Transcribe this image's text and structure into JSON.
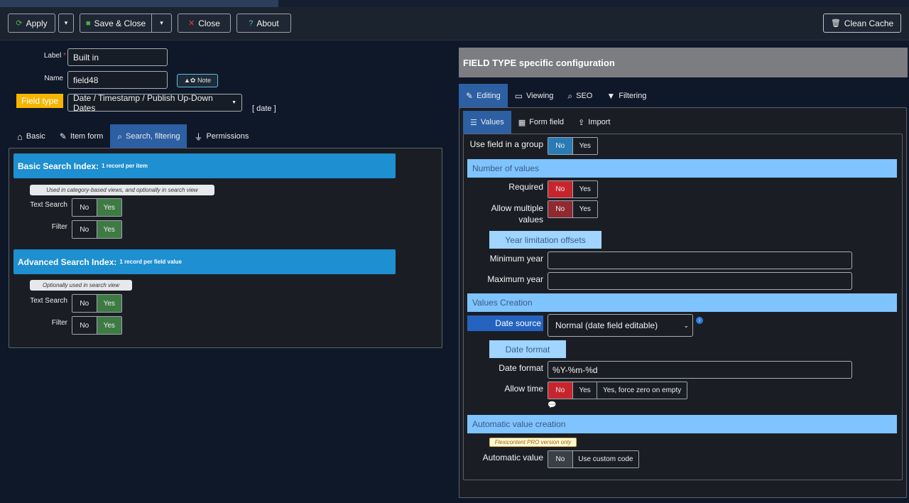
{
  "toolbar": {
    "apply": "Apply",
    "save_close": "Save & Close",
    "close": "Close",
    "about": "About",
    "clean_cache": "Clean Cache",
    "dropdown": "▾"
  },
  "form": {
    "label_label": "Label",
    "required_mark": "*",
    "label_value": "Built in",
    "name_label": "Name",
    "name_value": "field48",
    "note_button": "▲✿ Note",
    "field_type_label": "Field type",
    "field_type_value": "Date / Timestamp / Publish Up-Down Dates",
    "field_type_tag": "[ date ]"
  },
  "left_tabs": [
    {
      "icon": "home-icon",
      "label": "Basic"
    },
    {
      "icon": "edit-icon",
      "label": "Item form"
    },
    {
      "icon": "search-icon",
      "label": "Search, filtering"
    },
    {
      "icon": "plug-icon",
      "label": "Permissions"
    }
  ],
  "basic_index": {
    "title": "Basic Search Index:",
    "subtitle": "1 record per item",
    "note": "Used in category-based views, and optionally in search view",
    "text_search_label": "Text Search",
    "filter_label": "Filter",
    "no": "No",
    "yes": "Yes"
  },
  "advanced_index": {
    "title": "Advanced Search Index:",
    "subtitle": "1 record per field value",
    "note": "Optionally used in search view",
    "text_search_label": "Text Search",
    "filter_label": "Filter",
    "no": "No",
    "yes": "Yes"
  },
  "right": {
    "header": "FIELD TYPE specific configuration",
    "tabs": [
      {
        "icon": "edit-icon",
        "label": "Editing"
      },
      {
        "icon": "monitor-icon",
        "label": "Viewing"
      },
      {
        "icon": "search-icon",
        "label": "SEO"
      },
      {
        "icon": "filter-icon",
        "label": "Filtering"
      }
    ],
    "subtabs": [
      {
        "icon": "database-icon",
        "label": "Values"
      },
      {
        "icon": "calendar-icon",
        "label": "Form field"
      },
      {
        "icon": "upload-icon",
        "label": "Import"
      }
    ],
    "use_in_group_label": "Use field in a group",
    "number_of_values": "Number of values",
    "required_label": "Required",
    "allow_multiple_label1": "Allow multiple",
    "allow_multiple_label2": "values",
    "year_limitation": "Year limitation offsets",
    "min_year_label": "Minimum year",
    "max_year_label": "Maximum year",
    "values_creation": "Values Creation",
    "date_source_label": "Date source",
    "date_source_value": "Normal (date field editable)",
    "date_format_head": "Date format",
    "date_format_label": "Date format",
    "date_format_value": "%Y-%m-%d",
    "allow_time_label": "Allow time",
    "force_zero": "Yes, force zero on empty",
    "auto_creation": "Automatic value creation",
    "pro_only": "Flexicontent PRO version only",
    "auto_value_label": "Automatic value",
    "custom_code": "Use custom code",
    "no": "No",
    "yes": "Yes"
  },
  "colors": {
    "accent": "#2d5fa3",
    "section": "#1e8fd0",
    "bar": "#7fc4ff",
    "field_type": "#f7b500",
    "no_red": "#c7252d",
    "yes_green": "#3e7a44"
  }
}
